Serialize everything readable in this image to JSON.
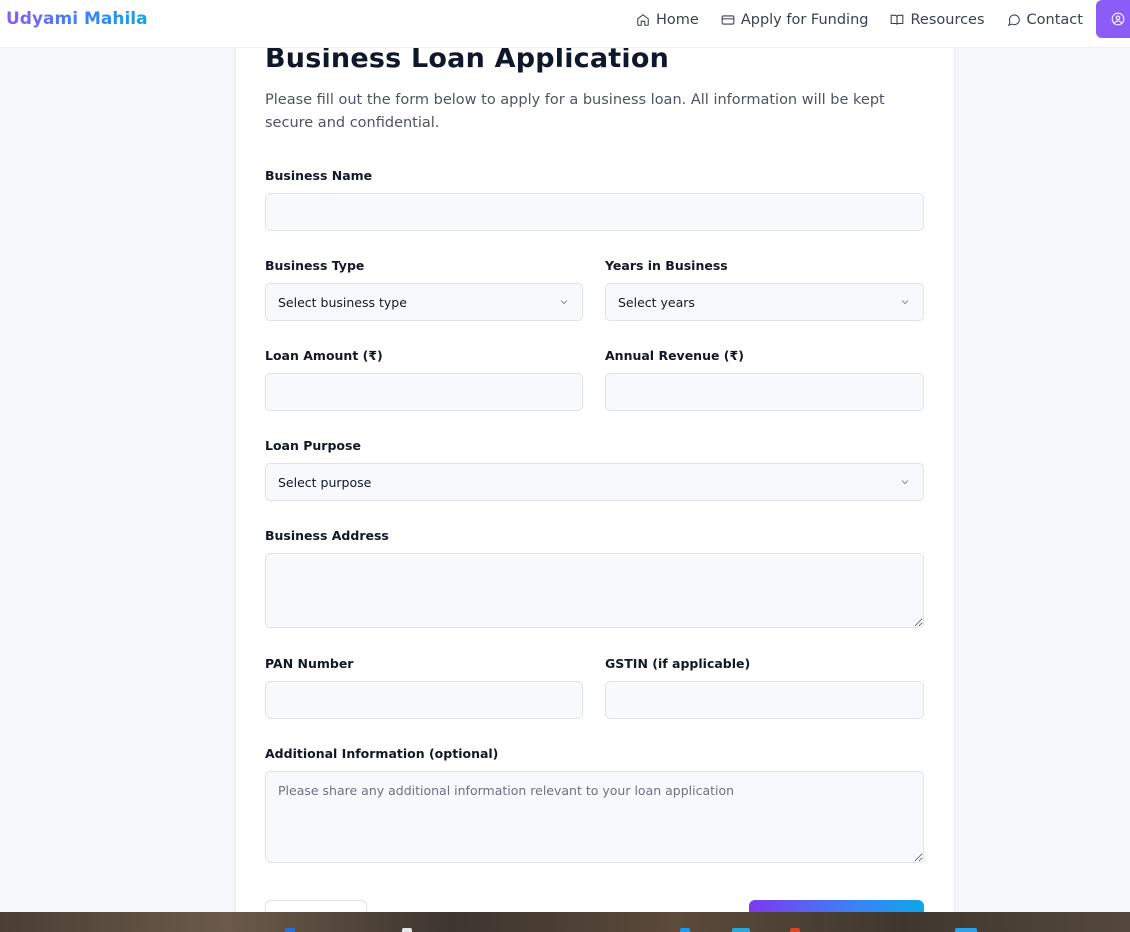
{
  "nav": {
    "brand": "Udyami Mahila",
    "links": [
      {
        "label": "Home",
        "icon": "home-icon"
      },
      {
        "label": "Apply for Funding",
        "icon": "credit-card-icon"
      },
      {
        "label": "Resources",
        "icon": "book-open-icon"
      },
      {
        "label": "Contact",
        "icon": "message-circle-icon"
      }
    ],
    "account_icon": "user-circle-icon"
  },
  "form": {
    "title": "Business Loan Application",
    "subtitle": "Please fill out the form below to apply for a business loan. All information will be kept secure and confidential.",
    "business_name": {
      "label": "Business Name",
      "value": ""
    },
    "business_type": {
      "label": "Business Type",
      "selected": "Select business type"
    },
    "years_in_business": {
      "label": "Years in Business",
      "selected": "Select years"
    },
    "loan_amount": {
      "label": "Loan Amount (₹)",
      "value": ""
    },
    "annual_revenue": {
      "label": "Annual Revenue (₹)",
      "value": ""
    },
    "loan_purpose": {
      "label": "Loan Purpose",
      "selected": "Select purpose"
    },
    "business_address": {
      "label": "Business Address",
      "value": ""
    },
    "pan_number": {
      "label": "PAN Number",
      "value": ""
    },
    "gstin": {
      "label": "GSTIN (if applicable)",
      "value": ""
    },
    "additional_info": {
      "label": "Additional Information (optional)",
      "placeholder": "Please share any additional information relevant to your loan application",
      "value": ""
    }
  },
  "colors": {
    "accent": "#8b5cf6",
    "brand_gradient_start": "#8b5cf6",
    "brand_gradient_end": "#0ea5e9",
    "page_bg": "#f7f8fc",
    "field_bg": "#f8f9fd"
  }
}
